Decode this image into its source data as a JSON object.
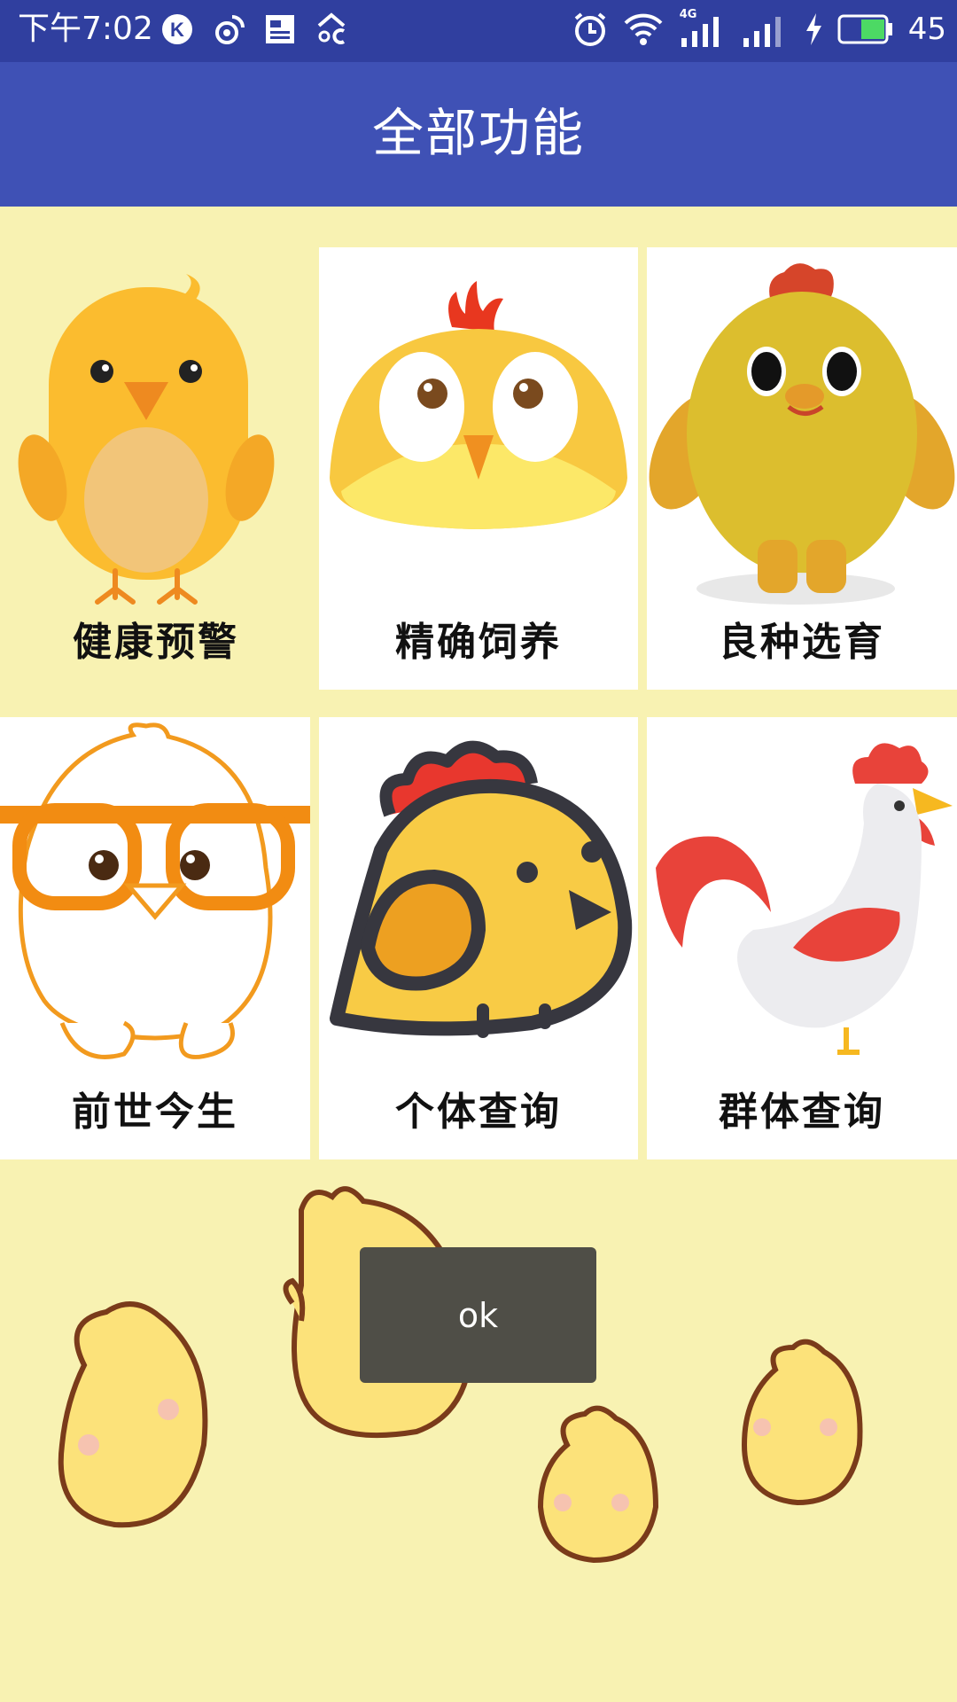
{
  "status_bar": {
    "time": "下午7:02",
    "left_icons": [
      "k-app-icon",
      "weibo-icon",
      "news-icon",
      "weather-icon"
    ],
    "right_icons": [
      "alarm-icon",
      "wifi-icon",
      "signal-4g-icon",
      "signal-icon",
      "charging-icon",
      "battery-icon"
    ],
    "network_label": "4G",
    "battery_level": "45"
  },
  "app_bar": {
    "title": "全部功能"
  },
  "grid": {
    "tiles": [
      {
        "label": "健康预警",
        "icon": "orange-chick-icon"
      },
      {
        "label": "精确饲养",
        "icon": "round-chick-icon"
      },
      {
        "label": "良种选育",
        "icon": "green-chick-icon"
      },
      {
        "label": "前世今生",
        "icon": "glasses-chick-icon"
      },
      {
        "label": "个体查询",
        "icon": "outlined-chick-icon"
      },
      {
        "label": "群体查询",
        "icon": "rooster-icon"
      }
    ]
  },
  "toast": {
    "text": "ok"
  },
  "colors": {
    "status_bar": "#303F9F",
    "app_bar": "#3F51B5",
    "background": "#F8F2B2",
    "toast": "#4F4E47"
  }
}
